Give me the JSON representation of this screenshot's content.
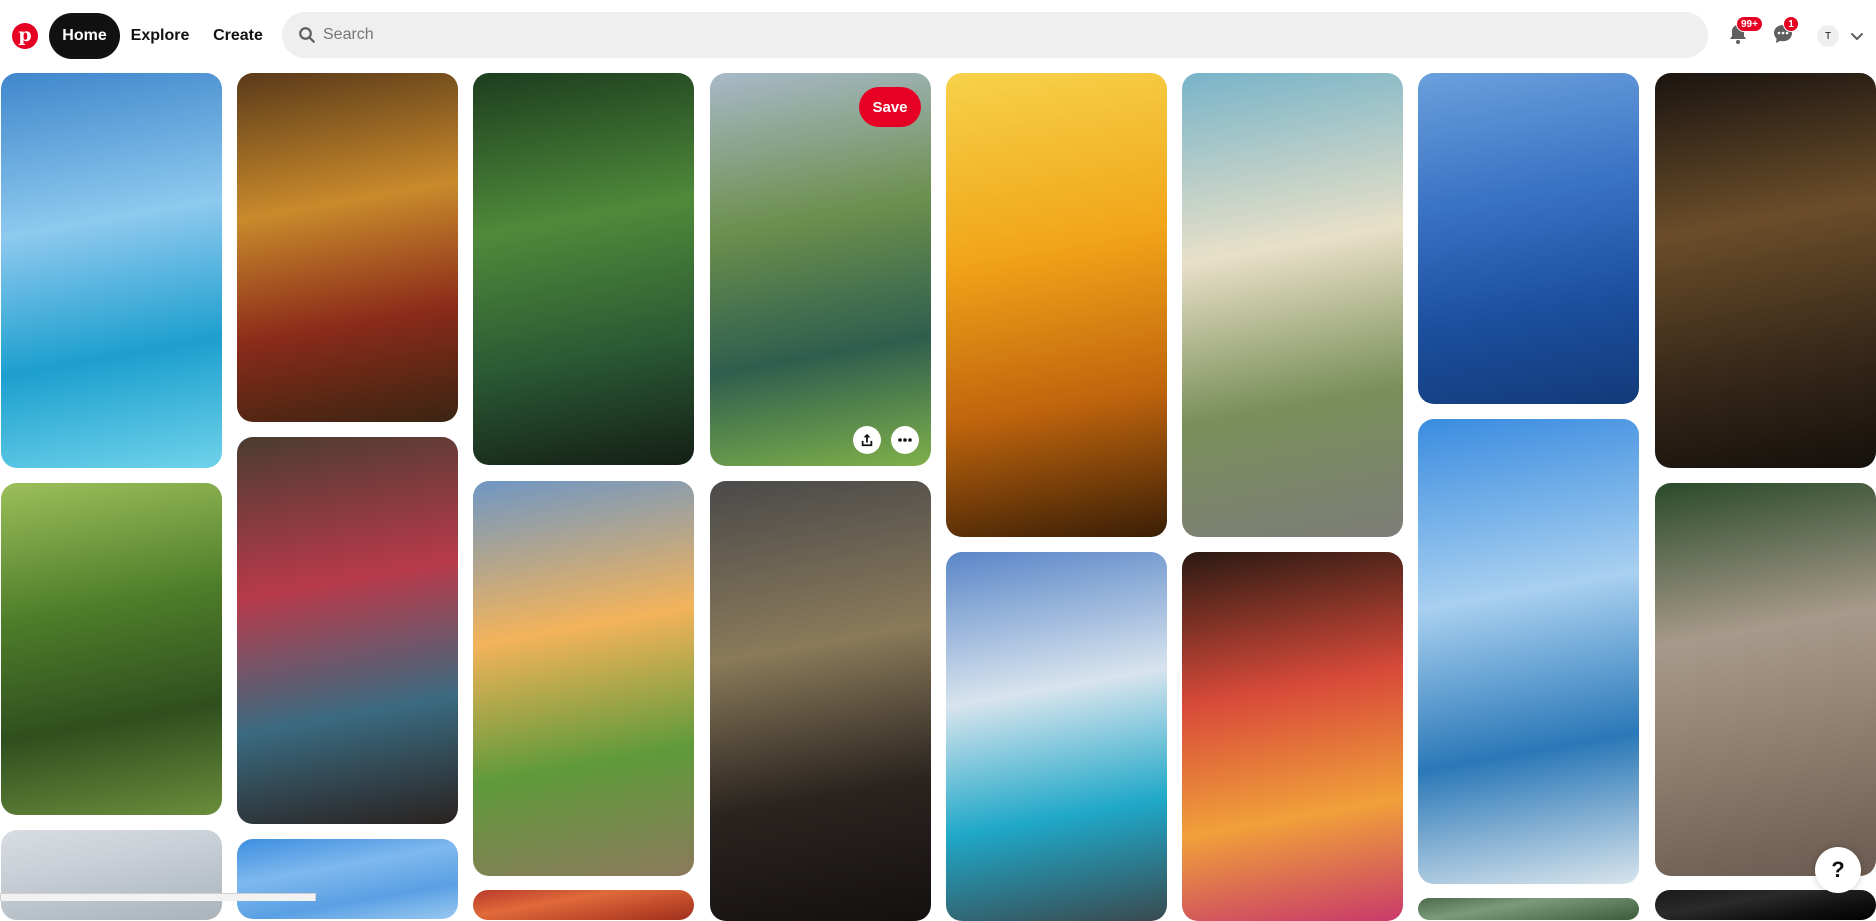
{
  "header": {
    "logo_icon": "pinterest-logo-icon",
    "nav": {
      "home": "Home",
      "explore": "Explore",
      "create": "Create"
    },
    "search": {
      "placeholder": "Search",
      "value": ""
    },
    "notifications": {
      "icon": "bell-icon",
      "badge": "99+"
    },
    "messages": {
      "icon": "chat-bubble-icon",
      "badge": "1"
    },
    "avatar_initial": "T"
  },
  "pin_overlay": {
    "save_label": "Save",
    "share_icon": "share-icon",
    "more_icon": "more-horizontal-icon"
  },
  "help_label": "?",
  "colors": {
    "brand": "#e60023",
    "nav_active_bg": "#111111",
    "search_bg": "#efefef"
  },
  "pins": [
    {
      "name": "pin-tropical-lagoon",
      "colors": [
        "#3f87cc",
        "#8ec9ee",
        "#1d9fcf",
        "#6fd3ea"
      ]
    },
    {
      "name": "pin-hanuman-art",
      "colors": [
        "#5a3a1a",
        "#c98a2b",
        "#8b2b1a",
        "#3a2412"
      ]
    },
    {
      "name": "pin-forest-stream",
      "colors": [
        "#1d3d1f",
        "#4f8a3a",
        "#2b5a34",
        "#141f16"
      ]
    },
    {
      "name": "pin-mountain-lake",
      "colors": [
        "#a8b9c8",
        "#6b8f4d",
        "#2f5e4e",
        "#7fb04a"
      ]
    },
    {
      "name": "pin-krishna-sunset",
      "colors": [
        "#f6d24a",
        "#f1a519",
        "#c0650d",
        "#3a1e06"
      ]
    },
    {
      "name": "pin-palm-street",
      "colors": [
        "#78b4c9",
        "#e8e0c8",
        "#7a8f5a",
        "#7d7d78"
      ]
    },
    {
      "name": "pin-blue-ocean",
      "colors": [
        "#6aa0dc",
        "#3a72c4",
        "#1c4f9e",
        "#123a7a"
      ]
    },
    {
      "name": "pin-leopard",
      "colors": [
        "#1a1410",
        "#6b4d2a",
        "#3a2a1a",
        "#14100c"
      ]
    },
    {
      "name": "pin-green-river",
      "colors": [
        "#9bbf5a",
        "#4e7d2a",
        "#2f4f1e",
        "#6a8d3c"
      ]
    },
    {
      "name": "pin-ganesha-art",
      "colors": [
        "#4a3c30",
        "#b83a4a",
        "#3a6a80",
        "#2a2220"
      ]
    },
    {
      "name": "pin-country-road",
      "colors": [
        "#6f97c4",
        "#f3b35a",
        "#5f9a3a",
        "#8b7a5c"
      ]
    },
    {
      "name": "pin-sports-car",
      "colors": [
        "#4a4a4a",
        "#8a7a5a",
        "#2a2420",
        "#141010"
      ]
    },
    {
      "name": "pin-alpine-lake",
      "colors": [
        "#5a86c8",
        "#d8e4ee",
        "#1fa8c8",
        "#3a4a50"
      ]
    },
    {
      "name": "pin-flower-shop",
      "colors": [
        "#2a1a12",
        "#d84a3a",
        "#f0a03a",
        "#c83a6a"
      ]
    },
    {
      "name": "pin-beach-clouds",
      "colors": [
        "#3a8ce0",
        "#a8d0f0",
        "#2a78b8",
        "#d8e4ec"
      ]
    },
    {
      "name": "pin-cartoon-bike",
      "colors": [
        "#2a4a2a",
        "#a89a8a",
        "#8a7a6a",
        "#6a5a50"
      ]
    },
    {
      "name": "pin-palm-silhouette",
      "colors": [
        "#d8dde2",
        "#c8cfd6",
        "#b8c0c8",
        "#aab2ba"
      ]
    },
    {
      "name": "pin-blue-sky",
      "colors": [
        "#3c8ee0",
        "#7fb8ee",
        "#5aa0e4",
        "#9ac8f0"
      ]
    },
    {
      "name": "pin-red-art",
      "colors": [
        "#b83a2a",
        "#e06a3a",
        "#c04a2a",
        "#a0301e"
      ]
    },
    {
      "name": "pin-dark-bottom",
      "colors": [
        "#1a1a1a",
        "#2a2a2a",
        "#111111",
        "#000000"
      ]
    },
    {
      "name": "pin-green-bottom",
      "colors": [
        "#4a6a4a",
        "#7a9a7a",
        "#5a7a5a",
        "#3a5a3a"
      ]
    }
  ]
}
